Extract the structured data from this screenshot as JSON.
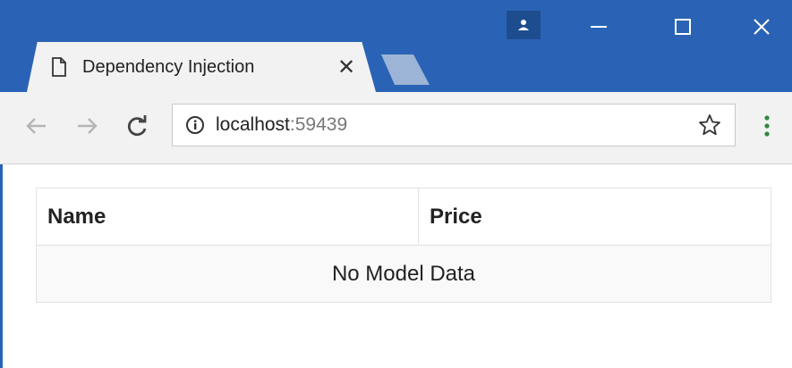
{
  "browser": {
    "tab": {
      "title": "Dependency Injection",
      "close_glyph": "✕"
    },
    "window_controls": {
      "minimize_glyph": "—",
      "maximize_glyph": "☐",
      "close_glyph": "✕"
    },
    "toolbar": {
      "back_glyph": "←",
      "forward_glyph": "→",
      "reload_glyph": "C",
      "url_host": "localhost",
      "url_port": ":59439",
      "bookmark_glyph": "☆",
      "menu_glyph": "⋮"
    },
    "colors": {
      "titlebar": "#2a63b5",
      "toolbar": "#f2f2f2",
      "menu_accent": "#2e8b3e"
    },
    "icons": [
      "document-icon",
      "profile-icon",
      "info-icon",
      "star-icon",
      "menu-dots-icon"
    ]
  },
  "table": {
    "headers": [
      "Name",
      "Price"
    ],
    "empty_message": "No Model Data"
  }
}
